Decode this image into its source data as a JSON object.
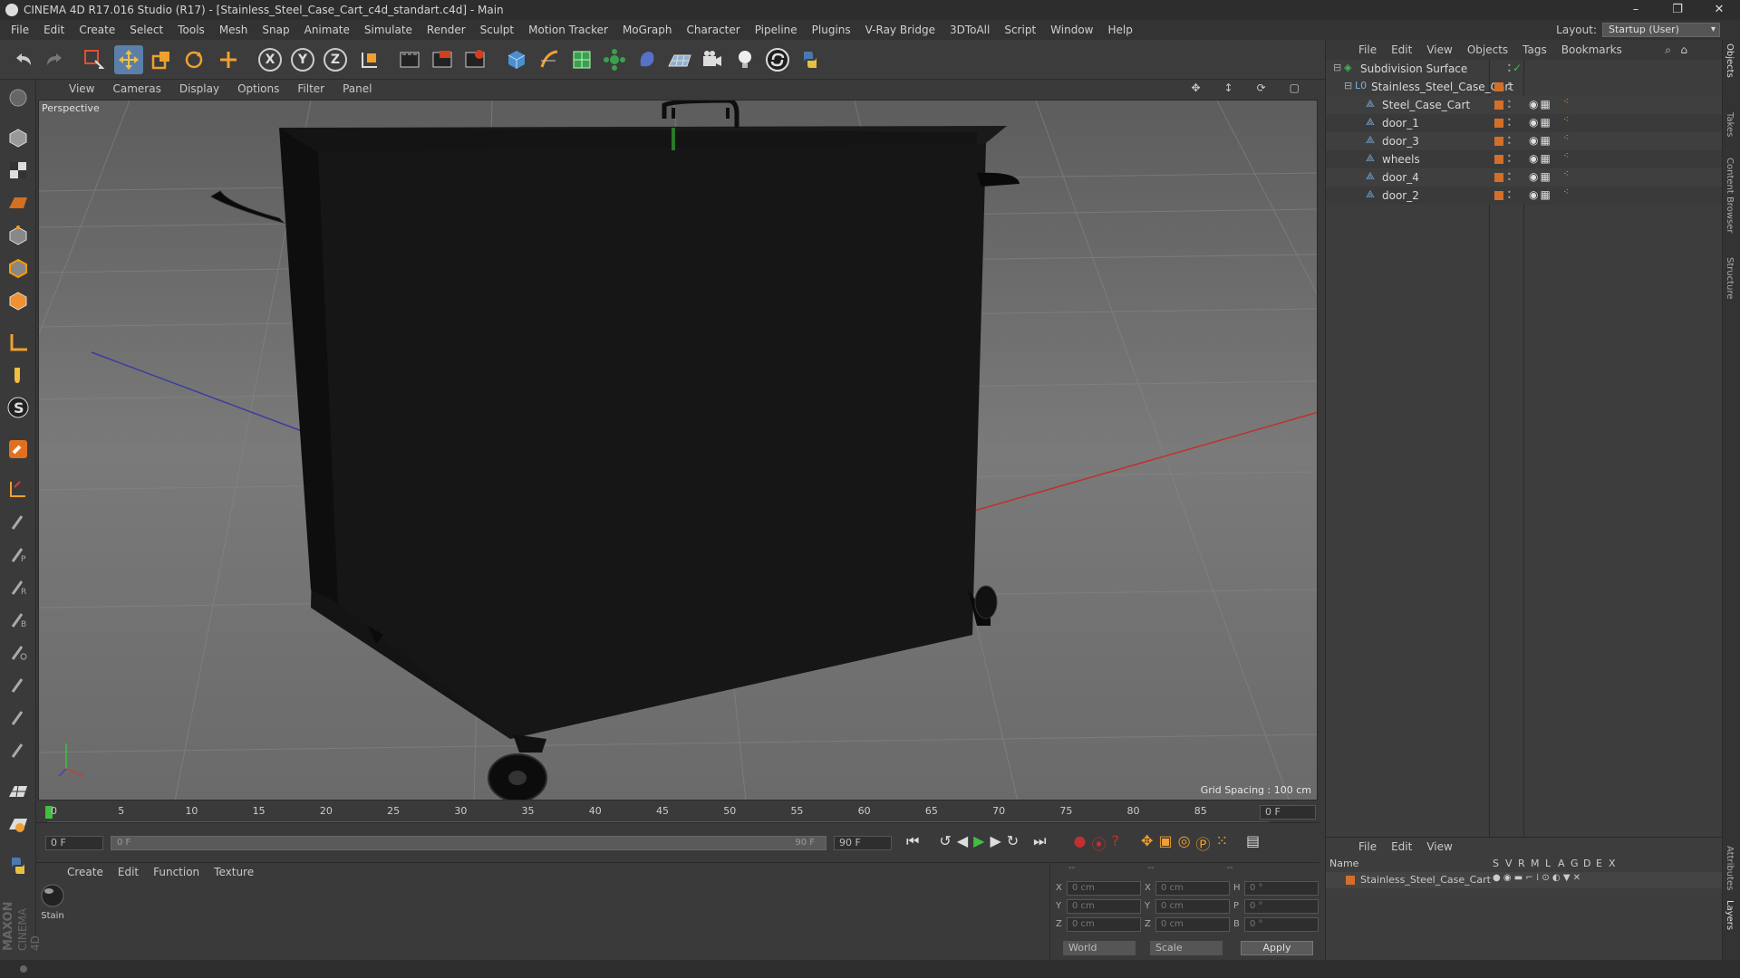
{
  "titlebar": {
    "title": "CINEMA 4D R17.016 Studio (R17) - [Stainless_Steel_Case_Cart_c4d_standart.c4d] - Main",
    "minimize": "–",
    "restore": "❐",
    "close": "✕"
  },
  "menubar": [
    "File",
    "Edit",
    "Create",
    "Select",
    "Tools",
    "Mesh",
    "Snap",
    "Animate",
    "Simulate",
    "Render",
    "Sculpt",
    "Motion Tracker",
    "MoGraph",
    "Character",
    "Pipeline",
    "Plugins",
    "V-Ray Bridge",
    "3DToAll",
    "Script",
    "Window",
    "Help"
  ],
  "layout": {
    "label": "Layout:",
    "value": "Startup (User)"
  },
  "toolbar": {
    "axis_x": "X",
    "axis_y": "Y",
    "axis_z": "Z",
    "icons": [
      "undo-icon",
      "redo-icon",
      "live-select-icon",
      "move-icon",
      "scale-icon",
      "rotate-icon",
      "last-tool-icon",
      "axis-x-icon",
      "axis-y-icon",
      "axis-z-icon",
      "coordinate-system-icon",
      "render-view-icon",
      "render-region-icon",
      "render-settings-icon",
      "cube-icon",
      "pen-icon",
      "subdivision-icon",
      "array-icon",
      "deformer-icon",
      "floor-icon",
      "camera-icon",
      "light-icon",
      "python-icon",
      "scripts-icon"
    ]
  },
  "viewport": {
    "menu": [
      "View",
      "Cameras",
      "Display",
      "Options",
      "Filter",
      "Panel"
    ],
    "label": "Perspective",
    "grid_spacing": "Grid Spacing : 100 cm"
  },
  "timeline": {
    "ticks": [
      "0",
      "5",
      "10",
      "15",
      "20",
      "25",
      "30",
      "35",
      "40",
      "45",
      "50",
      "55",
      "60",
      "65",
      "70",
      "75",
      "80",
      "85",
      "90"
    ],
    "current_frame": "0 F",
    "start_field": "0 F",
    "range_start": "0 F",
    "range_end": "90 F",
    "end_field": "90 F"
  },
  "material_manager": {
    "menu": [
      "Create",
      "Edit",
      "Function",
      "Texture"
    ],
    "materials": [
      {
        "name": "Stain"
      }
    ]
  },
  "coordinates": {
    "header": [
      "--",
      "--",
      "--"
    ],
    "rows": [
      {
        "a": "X",
        "av": "0 cm",
        "b": "X",
        "bv": "0 cm",
        "c": "H",
        "cv": "0 °"
      },
      {
        "a": "Y",
        "av": "0 cm",
        "b": "Y",
        "bv": "0 cm",
        "c": "P",
        "cv": "0 °"
      },
      {
        "a": "Z",
        "av": "0 cm",
        "b": "Z",
        "bv": "0 cm",
        "c": "B",
        "cv": "0 °"
      }
    ],
    "world": "World",
    "scale": "Scale",
    "apply": "Apply"
  },
  "object_manager": {
    "menu": [
      "File",
      "Edit",
      "View",
      "Objects",
      "Tags",
      "Bookmarks"
    ],
    "objects": [
      {
        "name": "Subdivision Surface",
        "level": 0
      },
      {
        "name": "Stainless_Steel_Case_Cart",
        "level": 1
      },
      {
        "name": "Steel_Case_Cart",
        "level": 2
      },
      {
        "name": "door_1",
        "level": 2
      },
      {
        "name": "door_3",
        "level": 2
      },
      {
        "name": "wheels",
        "level": 2
      },
      {
        "name": "door_4",
        "level": 2
      },
      {
        "name": "door_2",
        "level": 2
      }
    ]
  },
  "layer_manager": {
    "menu": [
      "File",
      "Edit",
      "View"
    ],
    "columns": [
      "Name",
      "S",
      "V",
      "R",
      "M",
      "L",
      "A",
      "G",
      "D",
      "E",
      "X"
    ],
    "layers": [
      {
        "name": "Stainless_Steel_Case_Cart"
      }
    ]
  },
  "side_tabs": [
    "Objects",
    "Takes",
    "Content Browser",
    "Structure",
    "Attributes",
    "Layers"
  ],
  "branding": {
    "line1": "MAXON",
    "line2": "CINEMA 4D"
  },
  "colors": {
    "accent": "#5b7fa8",
    "layer_color": "#d26f2a",
    "x_axis": "#c03030",
    "y_axis": "#30c030",
    "z_axis": "#3030a0"
  }
}
